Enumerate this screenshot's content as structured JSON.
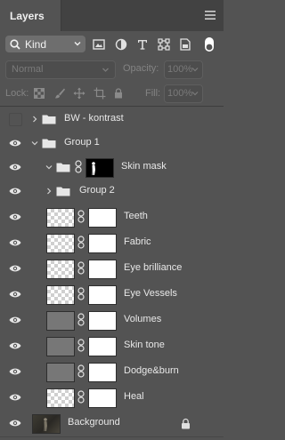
{
  "panel": {
    "title": "Layers"
  },
  "filter": {
    "kind_label": "Kind"
  },
  "blend": {
    "mode": "Normal",
    "opacity_label": "Opacity:",
    "opacity_value": "100%"
  },
  "locks": {
    "lock_label": "Lock:",
    "fill_label": "Fill:",
    "fill_value": "100%"
  },
  "layers": [
    {
      "name": "BW - kontrast"
    },
    {
      "name": "Group 1"
    },
    {
      "name": "Skin mask"
    },
    {
      "name": "Group 2"
    },
    {
      "name": "Teeth"
    },
    {
      "name": "Fabric"
    },
    {
      "name": "Eye brilliance"
    },
    {
      "name": "Eye Vessels"
    },
    {
      "name": "Volumes"
    },
    {
      "name": "Skin tone"
    },
    {
      "name": "Dodge&burn"
    },
    {
      "name": "Heal"
    },
    {
      "name": "Background"
    }
  ],
  "colors": {
    "panel_bg": "#535353",
    "tab_bar": "#424242",
    "row_separator": "#474747"
  }
}
